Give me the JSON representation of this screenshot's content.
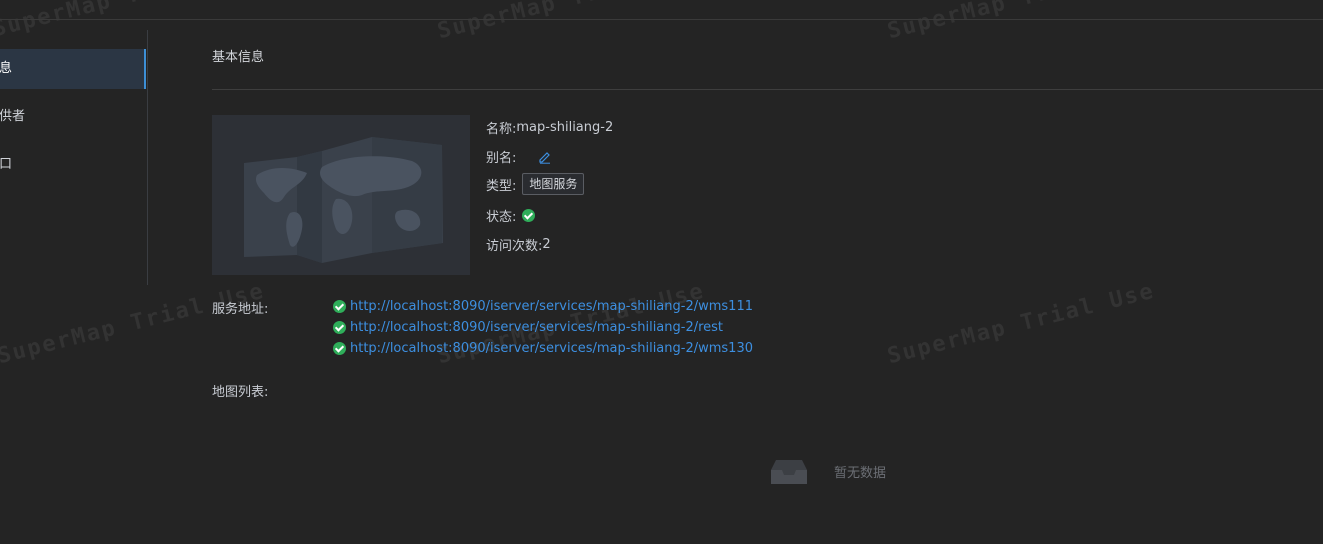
{
  "sidebar": {
    "items": [
      {
        "label": "信息",
        "active": true
      },
      {
        "label": "提供者",
        "active": false
      },
      {
        "label": "接口",
        "active": false
      }
    ]
  },
  "section": {
    "title": "基本信息"
  },
  "info": {
    "name_label": "名称:",
    "name_value": "map-shiliang-2",
    "alias_label": "别名:",
    "type_label": "类型:",
    "type_tag": "地图服务",
    "status_label": "状态:",
    "visits_label": "访问次数:",
    "visits_value": "2"
  },
  "service_address": {
    "label": "服务地址:",
    "urls": [
      "http://localhost:8090/iserver/services/map-shiliang-2/wms111",
      "http://localhost:8090/iserver/services/map-shiliang-2/rest",
      "http://localhost:8090/iserver/services/map-shiliang-2/wms130"
    ]
  },
  "map_list": {
    "label": "地图列表:",
    "empty_text": "暂无数据"
  },
  "watermark": {
    "text": "SuperMap Trial Use"
  },
  "colors": {
    "accent": "#3d8fe0",
    "success": "#2fae5a",
    "background": "#242424"
  }
}
